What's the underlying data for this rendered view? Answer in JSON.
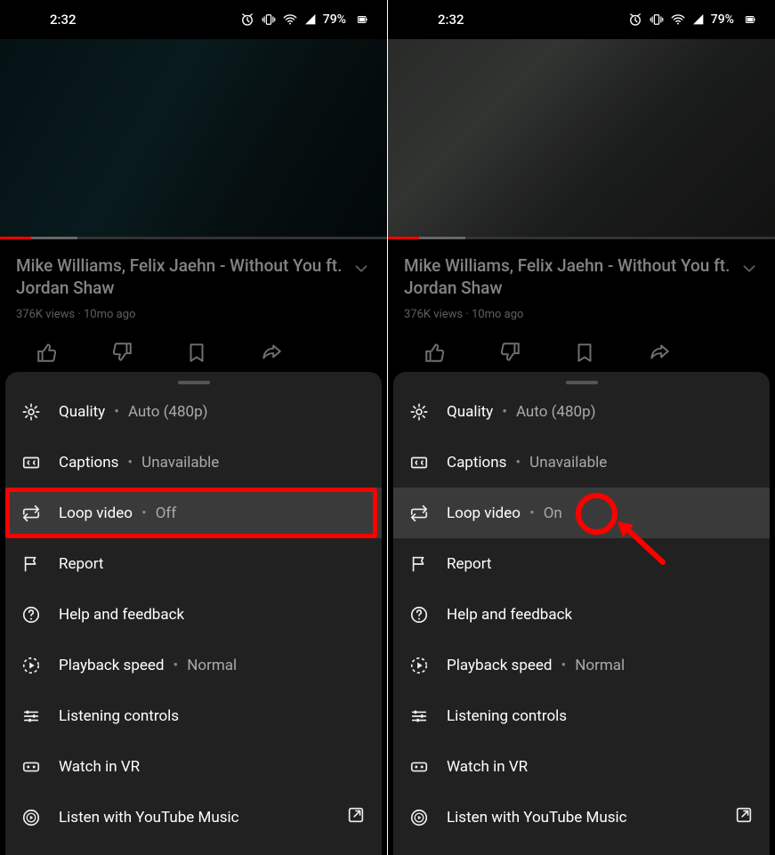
{
  "status": {
    "time": "2:32",
    "battery_pct": "79%"
  },
  "video": {
    "title": "Mike Williams, Felix Jaehn - Without You ft. Jordan Shaw",
    "views": "376K views",
    "separator": " · ",
    "age": "10mo ago"
  },
  "sheet": {
    "quality": {
      "label": "Quality",
      "value": "Auto (480p)"
    },
    "captions": {
      "label": "Captions",
      "value": "Unavailable"
    },
    "loop": {
      "label": "Loop video",
      "value_off": "Off",
      "value_on": "On"
    },
    "report": {
      "label": "Report"
    },
    "help": {
      "label": "Help and feedback"
    },
    "speed": {
      "label": "Playback speed",
      "value": "Normal"
    },
    "listening": {
      "label": "Listening controls"
    },
    "vr": {
      "label": "Watch in VR"
    },
    "ytmusic": {
      "label": "Listen with YouTube Music"
    }
  }
}
